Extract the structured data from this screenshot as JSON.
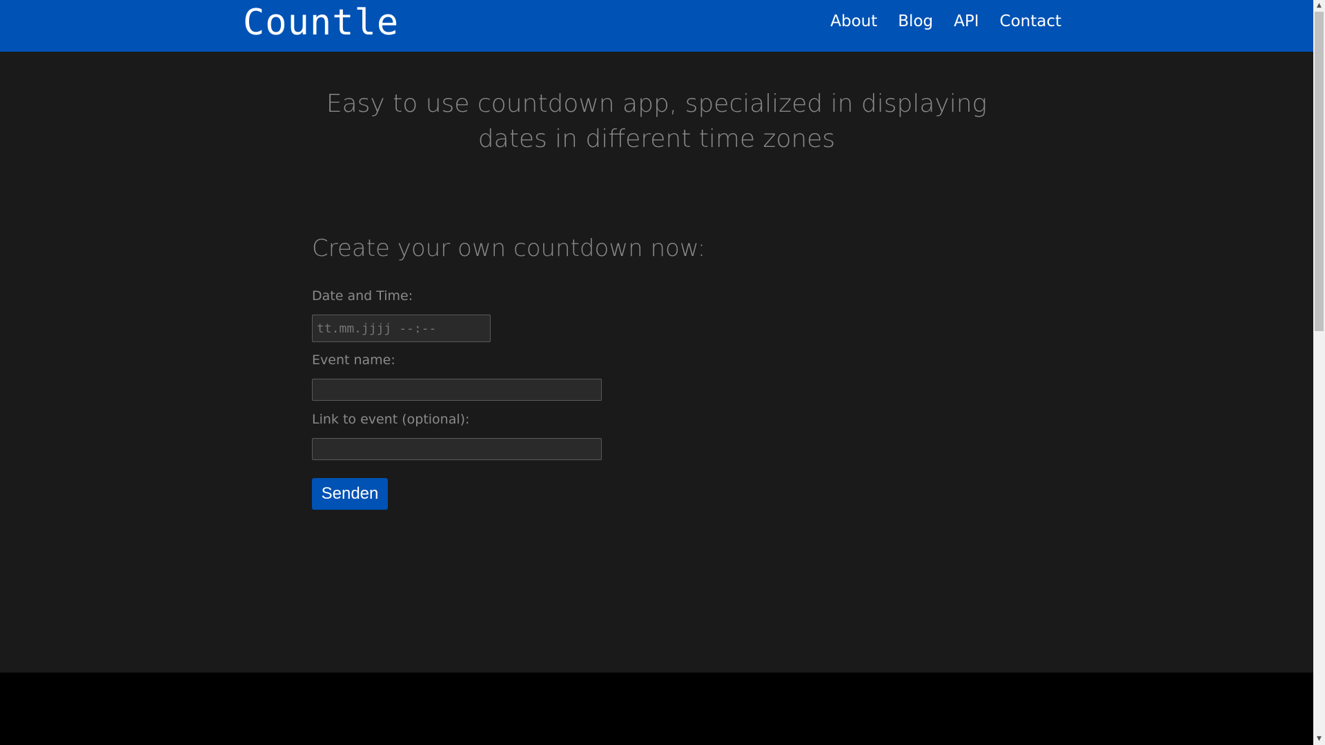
{
  "header": {
    "brand": "Countle",
    "nav": [
      "About",
      "Blog",
      "API",
      "Contact"
    ]
  },
  "main": {
    "tagline": "Easy to use countdown app, specialized in displaying dates in different time zones",
    "section_title": "Create your own countdown now:",
    "form": {
      "datetime_label": "Date and Time:",
      "datetime_placeholder": "tt.mm.jjjj --:--",
      "event_name_label": "Event name:",
      "event_name_value": "",
      "link_label": "Link to event (optional):",
      "link_value": "",
      "submit_label": "Senden"
    }
  },
  "colors": {
    "header_bg": "#0052b4",
    "body_bg": "#1a1a1a",
    "footer_bg": "#000000",
    "button_bg": "#0052b4"
  },
  "icons": {
    "scroll_up": "chevron-up-icon",
    "scroll_down": "chevron-down-icon"
  }
}
